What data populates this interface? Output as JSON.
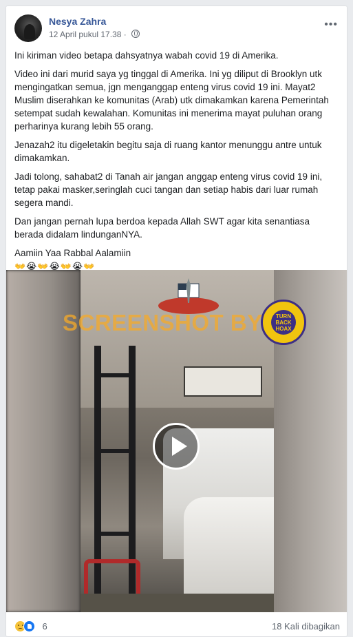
{
  "post": {
    "author": "Nesya Zahra",
    "timestamp": "12 April pukul 17.38",
    "privacy_icon": "globe-icon",
    "paragraphs": [
      "Ini kiriman video betapa dahsyatnya wabah covid 19 di Amerika.",
      "Video ini dari murid saya yg tinggal di Amerika. Ini yg diliput di Brooklyn utk mengingatkan semua, jgn menganggap enteng virus covid 19 ini. Mayat2 Muslim diserahkan ke komunitas (Arab) utk dimakamkan karena Pemerintah setempat sudah kewalahan. Komunitas ini menerima mayat puluhan orang perharinya kurang lebih 55 orang.",
      "Jenazah2 itu digeletakin begitu saja di ruang kantor menunggu antre untuk dimakamkan.",
      "Jadi tolong, sahabat2 di Tanah air jangan anggap enteng virus covid 19 ini, tetap pakai masker,seringlah cuci tangan dan setiap habis dari luar rumah segera mandi.",
      "Dan jangan pernah lupa berdoa kepada Allah SWT agar kita senantiasa berada didalam lindunganNYA.",
      "Aamiin Yaa Rabbal Aalamiin"
    ],
    "emoji_line": "👐😭👐😭👐😭👐"
  },
  "video": {
    "watermark": "SCREENSHOT BY",
    "badge_text": "TURN BACK HOAX"
  },
  "footer": {
    "reaction_count": "6",
    "shares": "18 Kali dibagikan"
  },
  "colors": {
    "author": "#385898",
    "background": "#e9ebee",
    "watermark": "#f5aa28",
    "badge_yellow": "#f1c40f",
    "badge_purple": "#3d2f85"
  }
}
